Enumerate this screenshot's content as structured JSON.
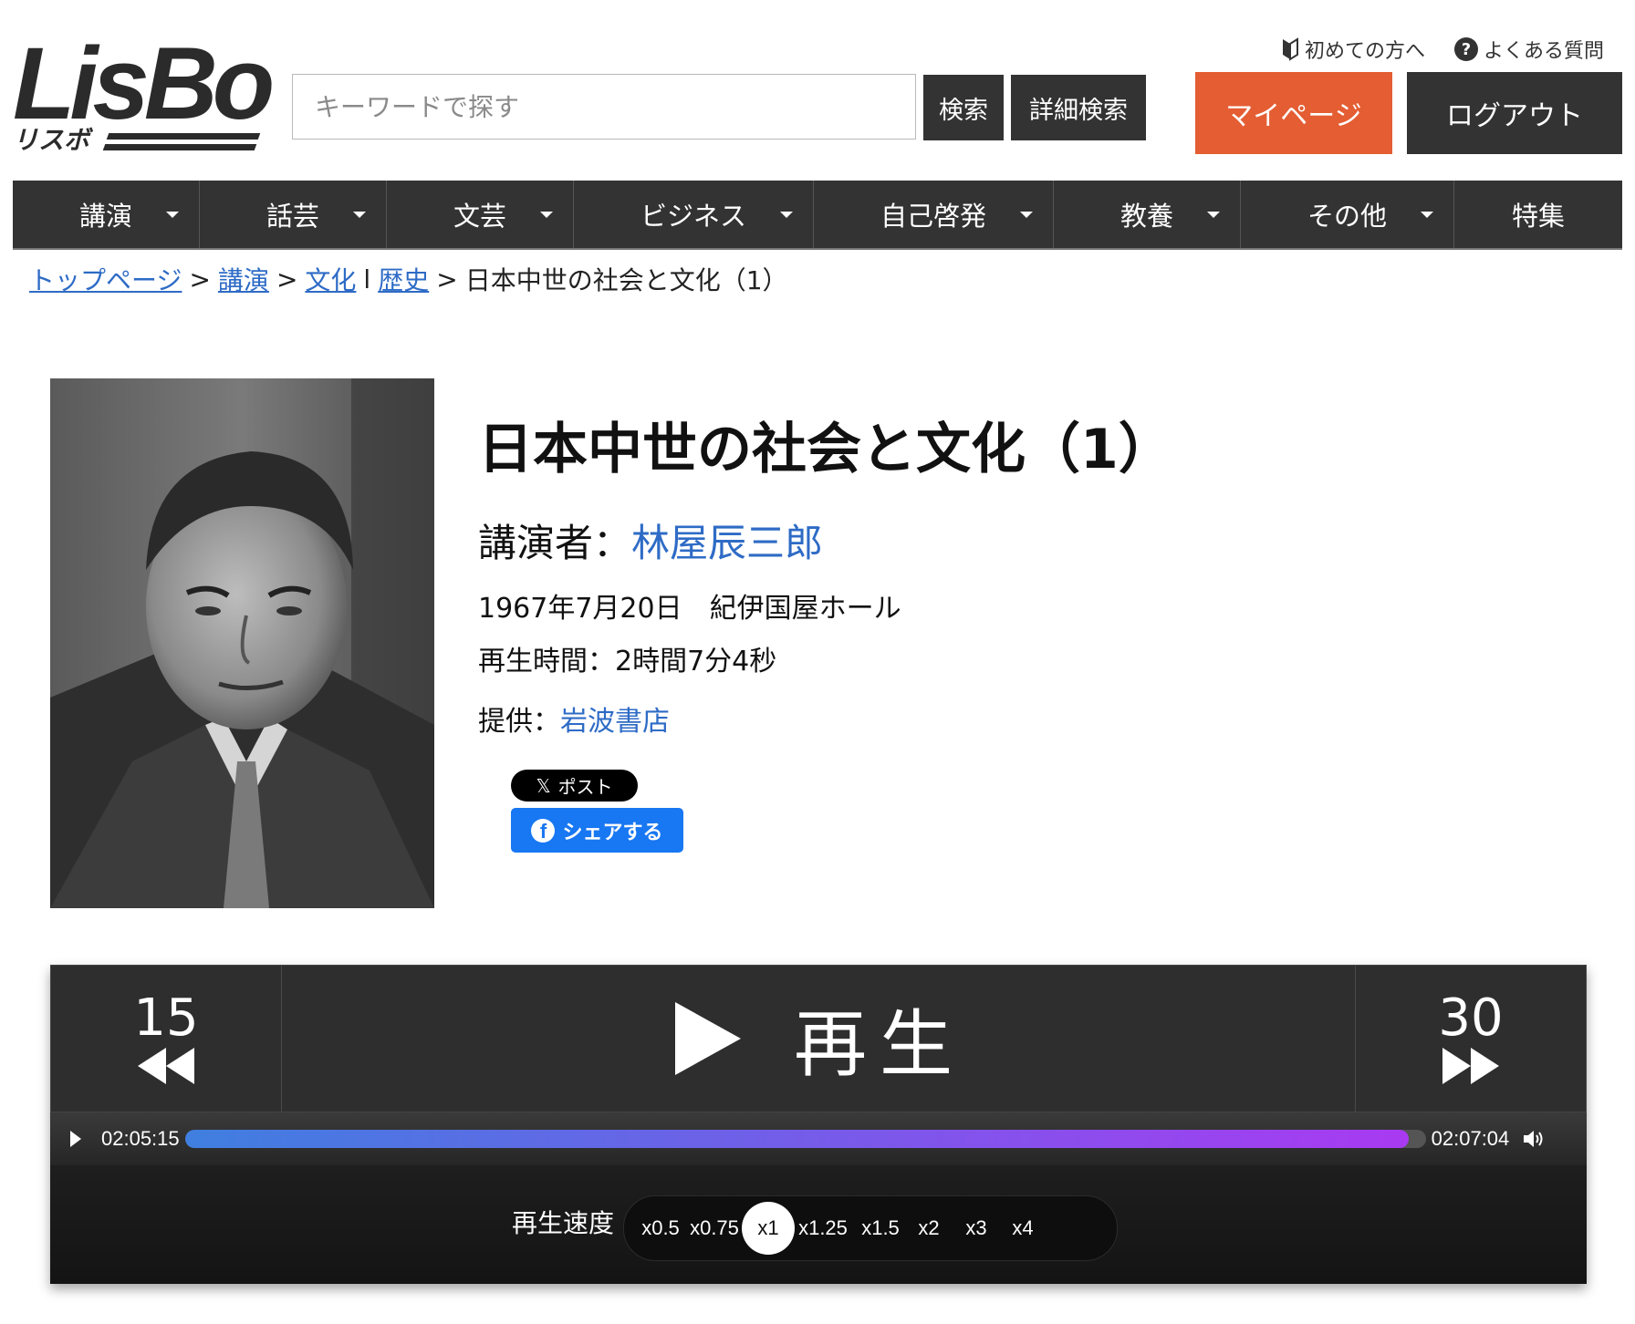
{
  "header": {
    "logo_text": "LisBo",
    "logo_subtext": "リスボ",
    "search_placeholder": "キーワードで探す",
    "search_button": "検索",
    "advanced_search_button": "詳細検索",
    "beginner_link": "初めての方へ",
    "faq_link": "よくある質問",
    "mypage_button": "マイページ",
    "logout_button": "ログアウト",
    "accent_color": "#e45d33"
  },
  "nav": {
    "items": [
      {
        "label": "講演",
        "dropdown": true
      },
      {
        "label": "話芸",
        "dropdown": true
      },
      {
        "label": "文芸",
        "dropdown": true
      },
      {
        "label": "ビジネス",
        "dropdown": true
      },
      {
        "label": "自己啓発",
        "dropdown": true
      },
      {
        "label": "教養",
        "dropdown": true
      },
      {
        "label": "その他",
        "dropdown": true
      },
      {
        "label": "特集",
        "dropdown": false
      }
    ]
  },
  "breadcrumb": {
    "top": "トップページ",
    "sep": ">",
    "category": "講演",
    "sub1": "文化",
    "divider": "l",
    "sub2": "歴史",
    "current": "日本中世の社会と文化（1）"
  },
  "lecture": {
    "title": "日本中世の社会と文化（1）",
    "speaker_label": "講演者：",
    "speaker_name": "林屋辰三郎",
    "date_venue": "1967年7月20日　紀伊国屋ホール",
    "duration_label": "再生時間：",
    "duration_value": "2時間7分4秒",
    "provider_label": "提供：",
    "provider_name": "岩波書店"
  },
  "social": {
    "x_post": "ポスト",
    "fb_share": "シェアする",
    "fb_color": "#1877f2"
  },
  "player": {
    "rewind_seconds": "15",
    "forward_seconds": "30",
    "play_label": "再生",
    "current_time": "02:05:15",
    "total_time": "02:07:04",
    "progress_fraction": 0.986,
    "speed_label": "再生速度",
    "speeds": [
      "x0.5",
      "x0.75",
      "x1",
      "x1.25",
      "x1.5",
      "x2",
      "x3",
      "x4"
    ],
    "selected_speed": "x1"
  }
}
